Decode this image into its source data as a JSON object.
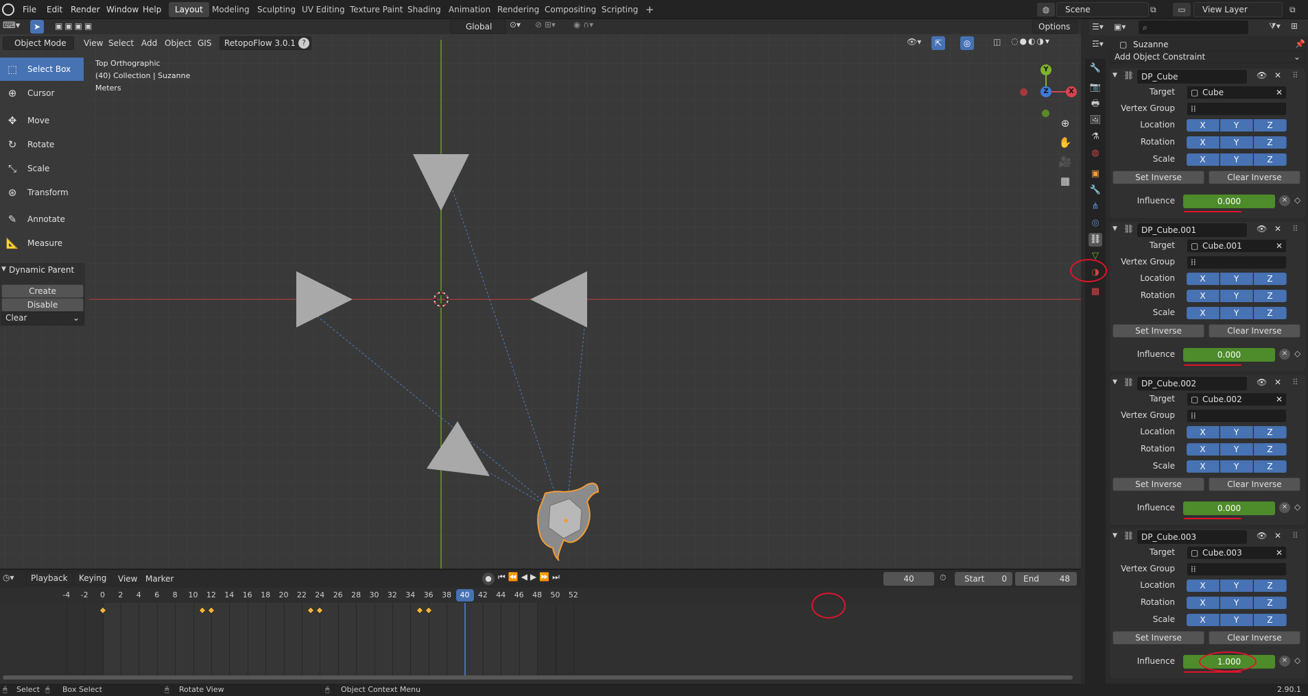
{
  "menu": {
    "items": [
      "File",
      "Edit",
      "Render",
      "Window",
      "Help"
    ]
  },
  "workspaces": {
    "tabs": [
      "Layout",
      "Modeling",
      "Sculpting",
      "UV Editing",
      "Texture Paint",
      "Shading",
      "Animation",
      "Rendering",
      "Compositing",
      "Scripting"
    ],
    "active": "Layout",
    "add": "+"
  },
  "scene": {
    "name": "Scene",
    "view_layer": "View Layer"
  },
  "viewport": {
    "mode": "Object Mode",
    "menus": [
      "View",
      "Select",
      "Add",
      "Object",
      "GIS",
      "RetopoFlow 3.0.1"
    ],
    "orientation": "Global",
    "options": "Options",
    "overlay_lines": [
      "Top Orthographic",
      "(40) Collection | Suzanne",
      "Meters"
    ],
    "gizmo": {
      "y": "Y",
      "z": "Z",
      "x": "X"
    }
  },
  "tools": [
    {
      "label": "Select Box",
      "icon": "select-box-icon"
    },
    {
      "label": "Cursor",
      "icon": "cursor-icon"
    },
    {
      "label": "Move",
      "icon": "move-icon"
    },
    {
      "label": "Rotate",
      "icon": "rotate-icon"
    },
    {
      "label": "Scale",
      "icon": "scale-icon"
    },
    {
      "label": "Transform",
      "icon": "transform-icon"
    },
    {
      "label": "Annotate",
      "icon": "annotate-icon"
    },
    {
      "label": "Measure",
      "icon": "measure-icon"
    }
  ],
  "dynamic_parent": {
    "title": "Dynamic Parent",
    "create": "Create",
    "disable": "Disable",
    "clear": "Clear"
  },
  "timeline": {
    "menus": [
      "Playback",
      "Keying",
      "View",
      "Marker"
    ],
    "current_frame": "40",
    "start_label": "Start",
    "start": "0",
    "end_label": "End",
    "end": "48",
    "ticks": [
      "-4",
      "-2",
      "0",
      "2",
      "4",
      "6",
      "8",
      "10",
      "12",
      "14",
      "16",
      "18",
      "20",
      "22",
      "24",
      "26",
      "28",
      "30",
      "32",
      "34",
      "36",
      "38",
      "40",
      "42",
      "44",
      "46",
      "48",
      "50",
      "52"
    ],
    "keyframes": [
      0,
      11,
      12,
      23,
      24,
      35,
      36
    ]
  },
  "status": {
    "select": "Select",
    "box_select": "Box Select",
    "rotate_view": "Rotate View",
    "context_menu": "Object Context Menu",
    "version": "2.90.1"
  },
  "properties": {
    "object": "Suzanne",
    "add_constraint": "Add Object Constraint",
    "labels": {
      "target": "Target",
      "vertex_group": "Vertex Group",
      "location": "Location",
      "rotation": "Rotation",
      "scale": "Scale",
      "set_inverse": "Set Inverse",
      "clear_inverse": "Clear Inverse",
      "influence": "Influence",
      "x": "X",
      "y": "Y",
      "z": "Z"
    },
    "constraints": [
      {
        "name": "DP_Cube",
        "target": "Cube",
        "influence": "0.000"
      },
      {
        "name": "DP_Cube.001",
        "target": "Cube.001",
        "influence": "0.000"
      },
      {
        "name": "DP_Cube.002",
        "target": "Cube.002",
        "influence": "0.000"
      },
      {
        "name": "DP_Cube.003",
        "target": "Cube.003",
        "influence": "1.000"
      }
    ]
  },
  "colors": {
    "accent": "#4772b3",
    "influence_green": "#4e8b2b",
    "annotation_red": "#e0142a",
    "selection_orange": "#f29d38"
  }
}
